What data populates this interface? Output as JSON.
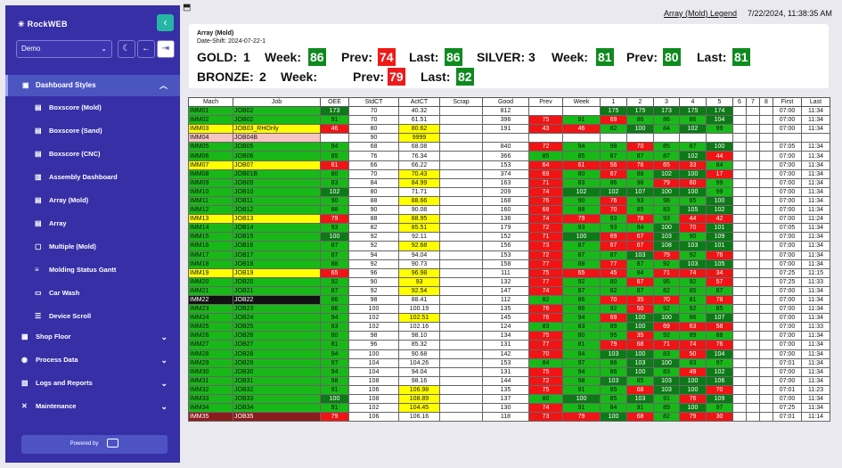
{
  "app": {
    "name": "RockWEB"
  },
  "sidebar": {
    "profile": "Demo",
    "section": {
      "label": "Dashboard Styles",
      "icon": "dashboard-icon"
    },
    "items": [
      {
        "label": "Boxscore (Mold)",
        "icon": "table-icon"
      },
      {
        "label": "Boxscore (Sand)",
        "icon": "table-icon"
      },
      {
        "label": "Boxscore (CNC)",
        "icon": "table-icon"
      },
      {
        "label": "Assembly Dashboard",
        "icon": "chart-icon"
      },
      {
        "label": "Array (Mold)",
        "icon": "table-icon"
      },
      {
        "label": "Array",
        "icon": "table-icon"
      },
      {
        "label": "Multiple (Mold)",
        "icon": "window-icon"
      },
      {
        "label": "Molding Status Gantt",
        "icon": "gantt-icon"
      },
      {
        "label": "Car Wash",
        "icon": "car-icon"
      },
      {
        "label": "Device Scroll",
        "icon": "layers-icon"
      }
    ],
    "groups": [
      {
        "label": "Shop Floor",
        "icon": "building-icon"
      },
      {
        "label": "Process Data",
        "icon": "database-icon"
      },
      {
        "label": "Logs and Reports",
        "icon": "report-icon"
      },
      {
        "label": "Maintenance",
        "icon": "wrench-icon"
      }
    ],
    "powered": "Powered by"
  },
  "header": {
    "legend_link": "Array (Mold) Legend",
    "timestamp": "7/22/2024, 11:38:35 AM"
  },
  "card": {
    "title": "Array (Mold)",
    "shift": "Date-Shift: 2024-07-22-1",
    "gold": {
      "label": "GOLD:",
      "count": "1",
      "week_label": "Week:",
      "week": "86",
      "prev_label": "Prev:",
      "prev": "74",
      "last_label": "Last:",
      "last": "86"
    },
    "silver": {
      "label": "SILVER:",
      "count": "3",
      "week_label": "Week:",
      "week": "81",
      "prev_label": "Prev:",
      "prev": "80",
      "last_label": "Last:",
      "last": "81"
    },
    "bronze": {
      "label": "BRONZE:",
      "count": "2",
      "week_label": "Week:",
      "prev_label": "Prev:",
      "prev": "79",
      "last_label": "Last:",
      "last": "82"
    }
  },
  "table": {
    "headers": [
      "Mach",
      "Job",
      "OEE",
      "StdCT",
      "ActCT",
      "Scrap",
      "Good",
      "Prev",
      "Week",
      "1",
      "2",
      "3",
      "4",
      "5",
      "6",
      "7",
      "8",
      "First",
      "Last"
    ],
    "rows": [
      [
        "IMM01",
        "JOB02",
        "173",
        "70",
        "40.32",
        "",
        "812",
        "",
        "",
        "175",
        "175",
        "173",
        "175",
        "174",
        "",
        "",
        "",
        "07:00",
        "11:34"
      ],
      [
        "IMM02",
        "JOB02",
        "91",
        "70",
        "61.51",
        "",
        "396",
        "75",
        "91",
        "69",
        "86",
        "86",
        "86",
        "104",
        "",
        "",
        "",
        "07:00",
        "11:34"
      ],
      [
        "IMM03",
        "JOB03_RHOnly",
        "46",
        "80",
        "80.62",
        "",
        "191",
        "43",
        "46",
        "82",
        "100",
        "84",
        "102",
        "99",
        "",
        "",
        "",
        "07:00",
        "11:34"
      ],
      [
        "IMM04",
        "JOB04B",
        "",
        "90",
        "9999",
        "",
        "",
        "",
        "",
        "",
        "",
        "",
        "",
        "",
        "",
        "",
        "",
        "",
        ""
      ],
      [
        "IMM05",
        "JOB05",
        "94",
        "68",
        "68.08",
        "",
        "840",
        "72",
        "94",
        "98",
        "70",
        "85",
        "87",
        "100",
        "",
        "",
        "",
        "07:05",
        "11:34"
      ],
      [
        "IMM06",
        "JOB06",
        "85",
        "76",
        "76.34",
        "",
        "366",
        "85",
        "85",
        "87",
        "87",
        "87",
        "102",
        "44",
        "",
        "",
        "",
        "07:00",
        "11:34"
      ],
      [
        "IMM07",
        "JOB07",
        "61",
        "66",
        "66.22",
        "",
        "153",
        "64",
        "61",
        "56",
        "76",
        "65",
        "33",
        "84",
        "",
        "",
        "",
        "07:00",
        "11:34"
      ],
      [
        "IMM08",
        "JOB01B",
        "80",
        "70",
        "70.43",
        "",
        "374",
        "69",
        "80",
        "67",
        "88",
        "102",
        "100",
        "17",
        "",
        "",
        "",
        "07:00",
        "11:34"
      ],
      [
        "IMM09",
        "JOB09",
        "83",
        "84",
        "84.99",
        "",
        "163",
        "71",
        "83",
        "86",
        "98",
        "79",
        "60",
        "99",
        "",
        "",
        "",
        "07:00",
        "11:34"
      ],
      [
        "IMM10",
        "JOB10",
        "102",
        "80",
        "71.71",
        "",
        "209",
        "74",
        "102",
        "102",
        "107",
        "100",
        "100",
        "99",
        "",
        "",
        "",
        "07:00",
        "11:34"
      ],
      [
        "IMM11",
        "JOB11",
        "90",
        "88",
        "88.66",
        "",
        "168",
        "76",
        "90",
        "76",
        "93",
        "98",
        "85",
        "100",
        "",
        "",
        "",
        "07:00",
        "11:34"
      ],
      [
        "IMM12",
        "JOB12",
        "88",
        "90",
        "90.08",
        "",
        "160",
        "69",
        "88",
        "70",
        "85",
        "83",
        "105",
        "102",
        "",
        "",
        "",
        "07:00",
        "11:34"
      ],
      [
        "IMM13",
        "JOB13",
        "79",
        "88",
        "88.95",
        "",
        "136",
        "74",
        "79",
        "93",
        "78",
        "93",
        "44",
        "42",
        "",
        "",
        "",
        "07:00",
        "11:24"
      ],
      [
        "IMM14",
        "JOB14",
        "93",
        "82",
        "85.51",
        "",
        "179",
        "72",
        "93",
        "93",
        "84",
        "100",
        "70",
        "101",
        "",
        "",
        "",
        "07:05",
        "11:34"
      ],
      [
        "IMM15",
        "JOB15",
        "100",
        "92",
        "92.11",
        "",
        "152",
        "71",
        "100",
        "69",
        "67",
        "103",
        "90",
        "109",
        "",
        "",
        "",
        "07:00",
        "11:34"
      ],
      [
        "IMM16",
        "JOB16",
        "87",
        "92",
        "92.68",
        "",
        "156",
        "73",
        "87",
        "67",
        "67",
        "108",
        "103",
        "101",
        "",
        "",
        "",
        "07:00",
        "11:34"
      ],
      [
        "IMM17",
        "JOB17",
        "87",
        "94",
        "94.04",
        "",
        "153",
        "72",
        "87",
        "87",
        "103",
        "79",
        "92",
        "76",
        "",
        "",
        "",
        "07:00",
        "11:34"
      ],
      [
        "IMM18",
        "JOB18",
        "88",
        "92",
        "90.73",
        "",
        "158",
        "77",
        "88",
        "77",
        "87",
        "92",
        "103",
        "105",
        "",
        "",
        "",
        "07:00",
        "11:34"
      ],
      [
        "IMM19",
        "JOB19",
        "65",
        "96",
        "96.98",
        "",
        "111",
        "75",
        "65",
        "45",
        "84",
        "71",
        "74",
        "34",
        "",
        "",
        "",
        "07:25",
        "11:15"
      ],
      [
        "IMM20",
        "JOB20",
        "92",
        "90",
        "93",
        "",
        "132",
        "77",
        "92",
        "80",
        "67",
        "95",
        "92",
        "57",
        "",
        "",
        "",
        "07:25",
        "11:33"
      ],
      [
        "IMM21",
        "JOB21",
        "87",
        "92",
        "92.54",
        "",
        "147",
        "74",
        "87",
        "82",
        "87",
        "82",
        "85",
        "87",
        "",
        "",
        "",
        "07:00",
        "11:34"
      ],
      [
        "IMM22",
        "JOB22",
        "86",
        "98",
        "88.41",
        "",
        "112",
        "82",
        "86",
        "70",
        "35",
        "70",
        "81",
        "78",
        "",
        "",
        "",
        "07:00",
        "11:34"
      ],
      [
        "IMM23",
        "JOB23",
        "86",
        "100",
        "100.19",
        "",
        "135",
        "76",
        "86",
        "92",
        "50",
        "92",
        "92",
        "85",
        "",
        "",
        "",
        "07:00",
        "11:34"
      ],
      [
        "IMM24",
        "JOB24",
        "94",
        "102",
        "102.51",
        "",
        "145",
        "76",
        "94",
        "69",
        "100",
        "100",
        "86",
        "107",
        "",
        "",
        "",
        "07:00",
        "11:34"
      ],
      [
        "IMM25",
        "JOB25",
        "83",
        "102",
        "102.16",
        "",
        "124",
        "83",
        "83",
        "89",
        "100",
        "69",
        "63",
        "58",
        "",
        "",
        "",
        "07:00",
        "11:33"
      ],
      [
        "IMM26",
        "JOB26",
        "80",
        "98",
        "98.10",
        "",
        "134",
        "75",
        "80",
        "95",
        "35",
        "92",
        "89",
        "88",
        "",
        "",
        "",
        "07:00",
        "11:34"
      ],
      [
        "IMM27",
        "JOB27",
        "81",
        "96",
        "85.32",
        "",
        "131",
        "77",
        "81",
        "79",
        "68",
        "71",
        "74",
        "76",
        "",
        "",
        "",
        "07:00",
        "11:34"
      ],
      [
        "IMM28",
        "JOB28",
        "94",
        "100",
        "90.68",
        "",
        "142",
        "70",
        "94",
        "103",
        "100",
        "83",
        "50",
        "104",
        "",
        "",
        "",
        "07:00",
        "11:34"
      ],
      [
        "IMM29",
        "JOB29",
        "97",
        "104",
        "104.26",
        "",
        "153",
        "84",
        "97",
        "86",
        "103",
        "100",
        "83",
        "97",
        "",
        "",
        "",
        "07:01",
        "11:34"
      ],
      [
        "IMM30",
        "JOB30",
        "94",
        "104",
        "94.04",
        "",
        "131",
        "75",
        "94",
        "86",
        "100",
        "83",
        "49",
        "102",
        "",
        "",
        "",
        "07:00",
        "11:34"
      ],
      [
        "IMM31",
        "JOB31",
        "98",
        "108",
        "98.16",
        "",
        "144",
        "72",
        "98",
        "103",
        "85",
        "103",
        "100",
        "106",
        "",
        "",
        "",
        "07:00",
        "11:34"
      ],
      [
        "IMM32",
        "JOB32",
        "91",
        "106",
        "106.98",
        "",
        "135",
        "75",
        "91",
        "85",
        "68",
        "103",
        "100",
        "70",
        "",
        "",
        "",
        "07:01",
        "11:23"
      ],
      [
        "IMM33",
        "JOB33",
        "100",
        "108",
        "108.89",
        "",
        "137",
        "80",
        "100",
        "85",
        "103",
        "91",
        "76",
        "109",
        "",
        "",
        "",
        "07:00",
        "11:34"
      ],
      [
        "IMM34",
        "JOB34",
        "91",
        "102",
        "104.45",
        "",
        "130",
        "74",
        "91",
        "84",
        "91",
        "89",
        "100",
        "97",
        "",
        "",
        "",
        "07:25",
        "11:34"
      ],
      [
        "IMM35",
        "JOB35",
        "79",
        "106",
        "106.16",
        "",
        "118",
        "73",
        "79",
        "100",
        "68",
        "82",
        "79",
        "30",
        "",
        "",
        "",
        "07:01",
        "11:14"
      ]
    ]
  },
  "colors": {
    "sidebar": "#362fa6",
    "good": "#19b819",
    "dark_good": "#0c7a16",
    "bad": "#f01414",
    "warn": "#ffff00",
    "accent": "#26b6a6"
  }
}
